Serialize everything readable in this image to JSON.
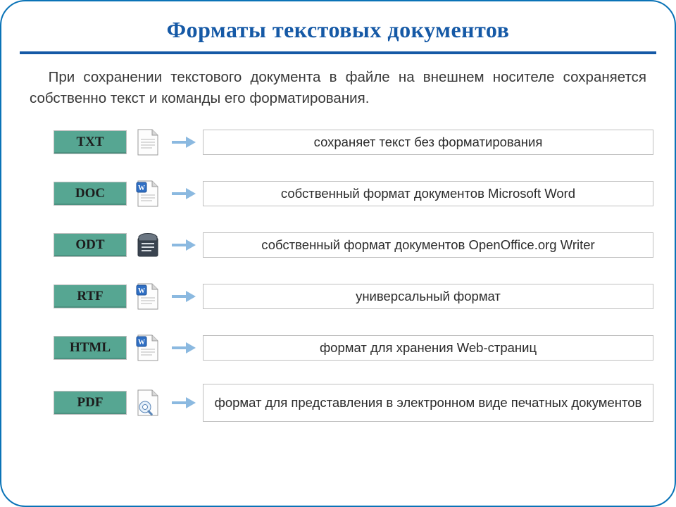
{
  "title": "Форматы текстовых документов",
  "intro": "При сохранении текстового документа в файле на внешнем носителе сохраняется собственно текст и команды его форматирования.",
  "formats": [
    {
      "code": "TXT",
      "icon": "txt-file-icon",
      "desc": "сохраняет текст без форматирования"
    },
    {
      "code": "DOC",
      "icon": "word-file-icon",
      "desc": "собственный формат документов Microsoft Word"
    },
    {
      "code": "ODT",
      "icon": "openoffice-icon",
      "desc": "собственный формат документов OpenOffice.org Writer"
    },
    {
      "code": "RTF",
      "icon": "rtf-file-icon",
      "desc": "универсальный формат"
    },
    {
      "code": "HTML",
      "icon": "html-file-icon",
      "desc": "формат для хранения Web-страниц"
    },
    {
      "code": "PDF",
      "icon": "pdf-file-icon",
      "desc": "формат для представления в электронном виде печатных документов"
    }
  ]
}
